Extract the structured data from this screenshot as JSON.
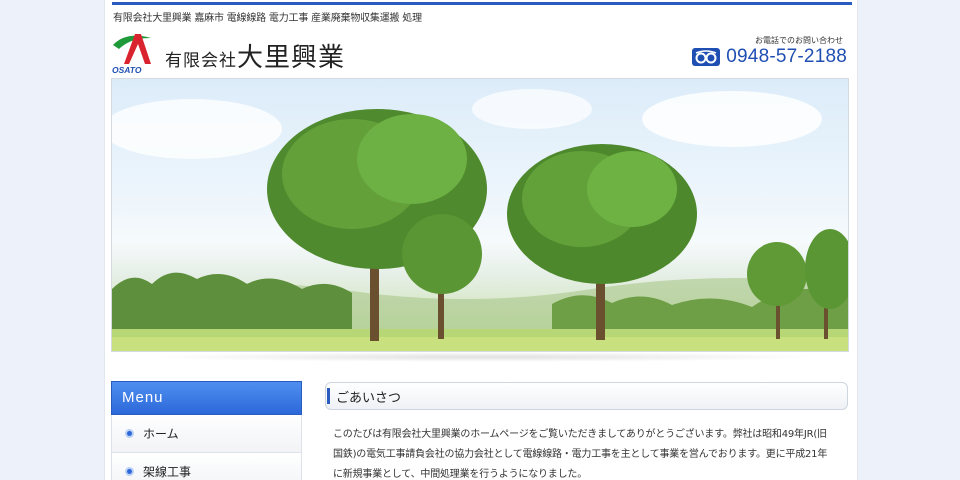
{
  "header": {
    "tagline": "有限会社大里興業 嘉麻市 電線線路 電力工事 産業廃棄物収集運搬 処理",
    "logo_text": "OSATO",
    "company_prefix": "有限会社",
    "company_main": "大里興業",
    "contact_label": "お電話でのお問い合わせ",
    "phone_number": "0948-57-2188"
  },
  "menu": {
    "title": "Menu",
    "items": [
      {
        "label": "ホーム"
      },
      {
        "label": "架線工事"
      }
    ]
  },
  "greeting": {
    "title": "ごあいさつ",
    "body": "このたびは有限会社大里興業のホームページをご覧いただきましてありがとうございます。弊社は昭和49年JR(旧国鉄)の電気工事請負会社の協力会社として電線線路・電力工事を主として事業を営んでおります。更に平成21年に新規事業として、中間処理業を行うようになりました。"
  },
  "colors": {
    "accent": "#2a5bbf",
    "menu_header": "#2c68d9",
    "logo_red": "#d9232e",
    "logo_green": "#1f9a3a"
  }
}
